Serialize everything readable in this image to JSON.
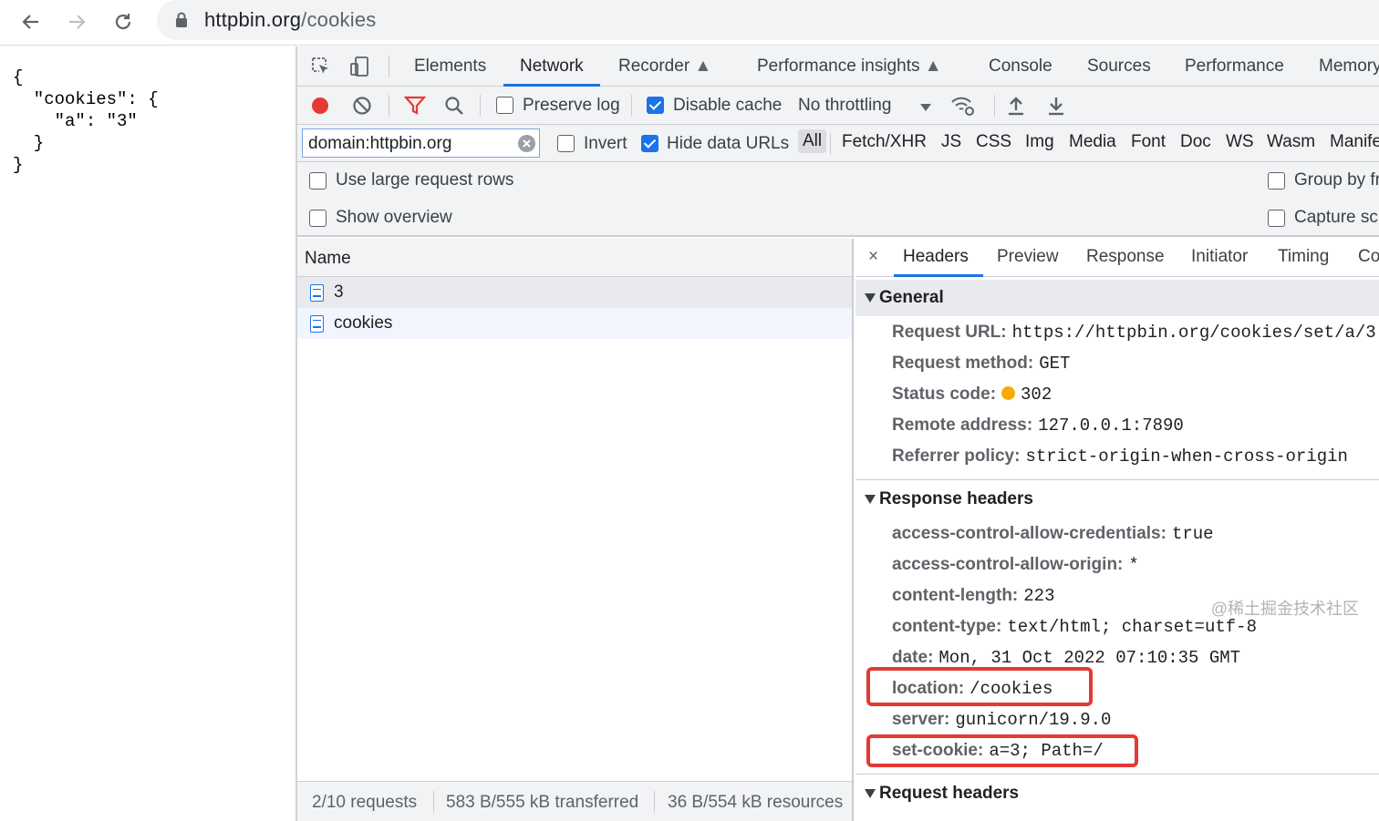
{
  "browser": {
    "url_host": "httpbin.org",
    "url_path": "/cookies",
    "icons": [
      "back-arrow-icon",
      "forward-arrow-icon",
      "reload-icon",
      "lock-icon"
    ]
  },
  "page": {
    "json_text": "{\n  \"cookies\": {\n    \"a\": \"3\"\n  }\n}"
  },
  "devtools": {
    "tabs": [
      "Elements",
      "Network",
      "Recorder",
      "Performance insights",
      "Console",
      "Sources",
      "Performance",
      "Memory"
    ],
    "active_tab": "Network",
    "toolbar": {
      "preserve_log": "Preserve log",
      "preserve_log_checked": false,
      "disable_cache": "Disable cache",
      "disable_cache_checked": true,
      "throttling": "No throttling"
    },
    "filter": {
      "value": "domain:httpbin.org",
      "invert": "Invert",
      "hide_data_urls": "Hide data URLs",
      "types": [
        "All",
        "Fetch/XHR",
        "JS",
        "CSS",
        "Img",
        "Media",
        "Font",
        "Doc",
        "WS",
        "Wasm",
        "Manife"
      ]
    },
    "settings": {
      "large_rows": "Use large request rows",
      "show_overview": "Show overview",
      "group_by": "Group by fr",
      "capture": "Capture scr"
    },
    "request_list": {
      "column": "Name",
      "rows": [
        "3",
        "cookies"
      ],
      "status": [
        "2/10 requests",
        "583 B/555 kB transferred",
        "36 B/554 kB resources"
      ]
    },
    "details": {
      "close": "×",
      "tabs": [
        "Headers",
        "Preview",
        "Response",
        "Initiator",
        "Timing",
        "Co"
      ],
      "general": {
        "title": "General",
        "rows": [
          {
            "k": "Request URL:",
            "v": "https://httpbin.org/cookies/set/a/3"
          },
          {
            "k": "Request method:",
            "v": "GET"
          },
          {
            "k": "Status code:",
            "v": "302"
          },
          {
            "k": "Remote address:",
            "v": "127.0.0.1:7890"
          },
          {
            "k": "Referrer policy:",
            "v": "strict-origin-when-cross-origin"
          }
        ]
      },
      "response_headers": {
        "title": "Response headers",
        "rows": [
          {
            "k": "access-control-allow-credentials:",
            "v": "true"
          },
          {
            "k": "access-control-allow-origin:",
            "v": "*"
          },
          {
            "k": "content-length:",
            "v": "223"
          },
          {
            "k": "content-type:",
            "v": "text/html; charset=utf-8"
          },
          {
            "k": "date:",
            "v": "Mon, 31 Oct 2022 07:10:35 GMT"
          },
          {
            "k": "location:",
            "v": "/cookies"
          },
          {
            "k": "server:",
            "v": "gunicorn/19.9.0"
          },
          {
            "k": "set-cookie:",
            "v": "a=3; Path=/"
          }
        ]
      },
      "request_headers": {
        "title": "Request headers"
      }
    },
    "highlight_color": "#e53935",
    "accent": "#1a73e8"
  },
  "watermark": "@稀土掘金技术社区"
}
